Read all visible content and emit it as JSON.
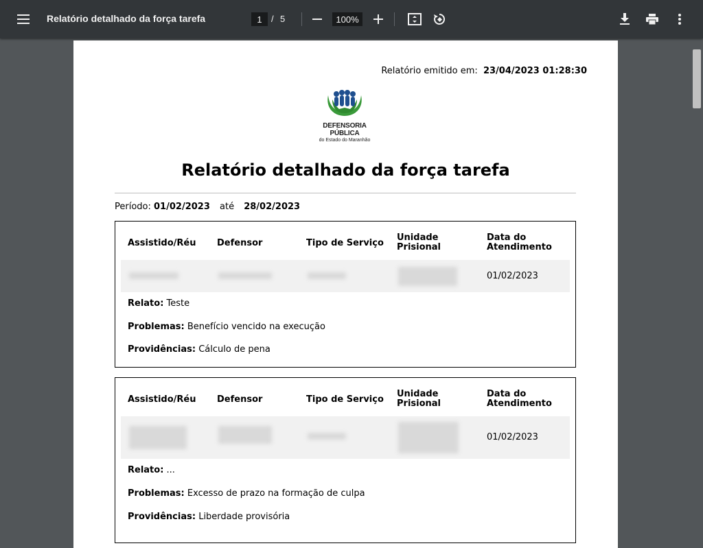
{
  "toolbar": {
    "title": "Relatório detalhado da força tarefa",
    "page_current": "1",
    "page_separator": "/",
    "page_total": "5",
    "zoom": "100%"
  },
  "report": {
    "issued_label": "Relatório emitido em:",
    "issued_value": "23/04/2023 01:28:30",
    "logo_line1": "DEFENSORIA PÚBLICA",
    "logo_line2": "do Estado do Maranhão",
    "heading": "Relatório detalhado da força tarefa",
    "period_label": "Período:",
    "period_start": "01/02/2023",
    "period_until": "até",
    "period_end": "28/02/2023"
  },
  "columns": {
    "c1": "Assistido/Réu",
    "c2": "Defensor",
    "c3": "Tipo de Serviço",
    "c4a": "Unidade",
    "c4b": "Prisional",
    "c5a": "Data do",
    "c5b": "Atendimento"
  },
  "records": [
    {
      "date": "01/02/2023",
      "relato_label": "Relato:",
      "relato": "Teste",
      "problemas_label": "Problemas:",
      "problemas": "Benefício vencido na execução",
      "providencias_label": "Providências:",
      "providencias": "Cálculo de pena"
    },
    {
      "date": "01/02/2023",
      "relato_label": "Relato:",
      "relato": "...",
      "problemas_label": "Problemas:",
      "problemas": "Excesso de prazo na formação de culpa",
      "providencias_label": "Providências:",
      "providencias": "Liberdade provisória"
    }
  ]
}
